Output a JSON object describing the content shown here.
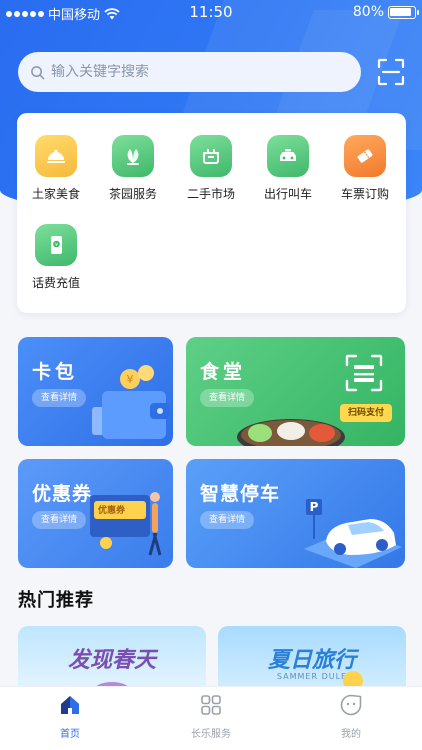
{
  "status_bar": {
    "carrier": "中国移动",
    "time": "11:50",
    "battery": "80%"
  },
  "search": {
    "placeholder": "输入关键字搜索"
  },
  "services": [
    {
      "label": "土家美食",
      "icon": "food-cloche-icon",
      "color": "#f6b93b"
    },
    {
      "label": "茶园服务",
      "icon": "tea-leaf-icon",
      "color": "#3fb86a"
    },
    {
      "label": "二手市场",
      "icon": "market-basket-icon",
      "color": "#3fb86a"
    },
    {
      "label": "出行叫车",
      "icon": "taxi-icon",
      "color": "#3fb86a"
    },
    {
      "label": "车票订购",
      "icon": "ticket-icon",
      "color": "#f07a2c"
    },
    {
      "label": "话费充值",
      "icon": "phone-recharge-icon",
      "color": "#3fb86a"
    }
  ],
  "features": {
    "card_pack": {
      "title": "卡包",
      "button": "查看详情"
    },
    "canteen": {
      "title": "食堂",
      "button": "查看详情",
      "pay": "扫码支付"
    },
    "coupon": {
      "title": "优惠券",
      "button": "查看详情",
      "ticket_text": "优惠券"
    },
    "parking": {
      "title": "智慧停车",
      "button": "查看详情"
    }
  },
  "recommend": {
    "title": "热门推荐",
    "items": [
      {
        "title": "发现春天"
      },
      {
        "title": "夏日旅行",
        "subtitle": "SAMMER DULE"
      }
    ]
  },
  "tabbar": [
    {
      "label": "首页",
      "active": true
    },
    {
      "label": "长乐服务",
      "active": false
    },
    {
      "label": "我的",
      "active": false
    }
  ],
  "colors": {
    "primary": "#2f6fe6",
    "green": "#3fb86a",
    "yellow": "#ffd84d"
  }
}
